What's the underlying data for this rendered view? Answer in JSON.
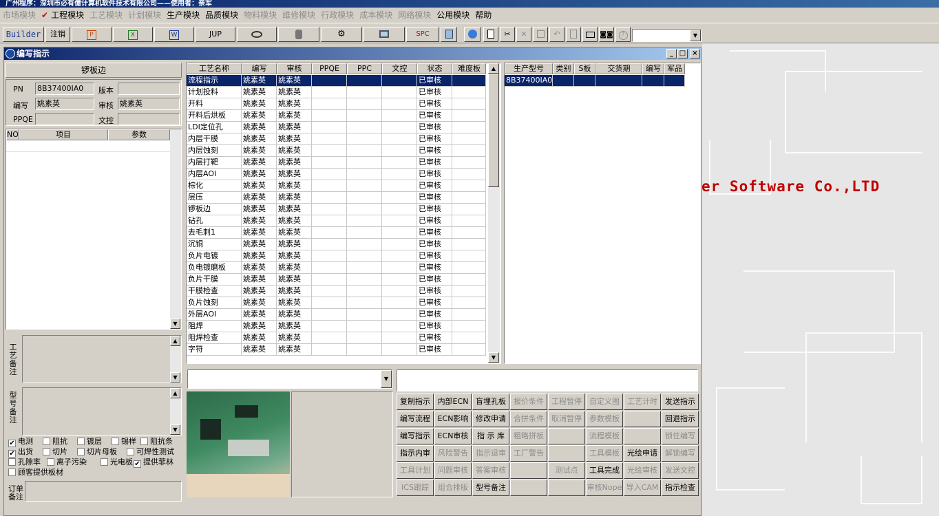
{
  "app": {
    "title": "广州程序：深圳市必有億计算机软件技术有限公司——使用者：亲军"
  },
  "menu": [
    {
      "label": "市场模块",
      "enabled": false
    },
    {
      "label": "工程模块",
      "enabled": true,
      "checked": true
    },
    {
      "label": "工艺模块",
      "enabled": false
    },
    {
      "label": "计划模块",
      "enabled": false
    },
    {
      "label": "生产模块",
      "enabled": true
    },
    {
      "label": "品质模块",
      "enabled": true
    },
    {
      "label": "物料模块",
      "enabled": false
    },
    {
      "label": "维修模块",
      "enabled": false
    },
    {
      "label": "行政模块",
      "enabled": false
    },
    {
      "label": "成本模块",
      "enabled": false
    },
    {
      "label": "网络模块",
      "enabled": false
    },
    {
      "label": "公用模块",
      "enabled": true
    },
    {
      "label": "帮助",
      "enabled": true
    }
  ],
  "toolbar": {
    "builder": "Builder",
    "logout": "注销",
    "jup": "JUP",
    "spc": "SPC"
  },
  "desktop": {
    "brand": "er Software Co.,LTD"
  },
  "window": {
    "title": "编写指示"
  },
  "left": {
    "header": "锣板边",
    "pn_label": "PN",
    "pn_value": "8B37400IA0",
    "version_label": "版本",
    "version_value": "",
    "writer_label": "编写",
    "writer_value": "姚素英",
    "review_label": "审核",
    "review_value": "姚素英",
    "ppqe_label": "PPQE",
    "ppqe_value": "",
    "doc_label": "文控",
    "doc_value": "",
    "param_cols": [
      "NO",
      "项目",
      "参数"
    ],
    "craft_note_label": "工艺备注",
    "model_note_label": "型号备注",
    "order_note_label": "订单备注",
    "checks": [
      [
        {
          "label": "电测",
          "checked": true
        },
        {
          "label": "阻抗",
          "checked": false
        },
        {
          "label": "镀层",
          "checked": false
        },
        {
          "label": "锡样",
          "checked": false
        },
        {
          "label": "阻抗条",
          "checked": false
        }
      ],
      [
        {
          "label": "出货",
          "checked": true
        },
        {
          "label": "切片",
          "checked": false
        },
        {
          "label": "切片母板",
          "checked": false
        },
        {
          "label": "可焊性测试",
          "checked": false
        }
      ],
      [
        {
          "label": "孔隙率",
          "checked": false
        },
        {
          "label": "离子污染",
          "checked": false
        },
        {
          "label": "光电板",
          "checked": false
        },
        {
          "label": "提供菲林",
          "checked": true
        }
      ],
      [
        {
          "label": "顾客提供板材",
          "checked": false
        }
      ]
    ]
  },
  "process": {
    "columns": [
      "工艺名称",
      "编写",
      "审核",
      "PPQE",
      "PPC",
      "文控",
      "状态",
      "难度板"
    ],
    "rows": [
      [
        "流程指示",
        "姚素英",
        "姚素英",
        "",
        "",
        "",
        "已审核",
        ""
      ],
      [
        "计划投料",
        "姚素英",
        "姚素英",
        "",
        "",
        "",
        "已审核",
        ""
      ],
      [
        "开料",
        "姚素英",
        "姚素英",
        "",
        "",
        "",
        "已审核",
        ""
      ],
      [
        "开料后烘板",
        "姚素英",
        "姚素英",
        "",
        "",
        "",
        "已审核",
        ""
      ],
      [
        "LDI定位孔",
        "姚素英",
        "姚素英",
        "",
        "",
        "",
        "已审核",
        ""
      ],
      [
        "内层干膜",
        "姚素英",
        "姚素英",
        "",
        "",
        "",
        "已审核",
        ""
      ],
      [
        "内层蚀刻",
        "姚素英",
        "姚素英",
        "",
        "",
        "",
        "已审核",
        ""
      ],
      [
        "内层打靶",
        "姚素英",
        "姚素英",
        "",
        "",
        "",
        "已审核",
        ""
      ],
      [
        "内层AOI",
        "姚素英",
        "姚素英",
        "",
        "",
        "",
        "已审核",
        ""
      ],
      [
        "棕化",
        "姚素英",
        "姚素英",
        "",
        "",
        "",
        "已审核",
        ""
      ],
      [
        "层压",
        "姚素英",
        "姚素英",
        "",
        "",
        "",
        "已审核",
        ""
      ],
      [
        "锣板边",
        "姚素英",
        "姚素英",
        "",
        "",
        "",
        "已审核",
        ""
      ],
      [
        "钻孔",
        "姚素英",
        "姚素英",
        "",
        "",
        "",
        "已审核",
        ""
      ],
      [
        "去毛刺1",
        "姚素英",
        "姚素英",
        "",
        "",
        "",
        "已审核",
        ""
      ],
      [
        "沉铜",
        "姚素英",
        "姚素英",
        "",
        "",
        "",
        "已审核",
        ""
      ],
      [
        "负片电镀",
        "姚素英",
        "姚素英",
        "",
        "",
        "",
        "已审核",
        ""
      ],
      [
        "负电镀磨板",
        "姚素英",
        "姚素英",
        "",
        "",
        "",
        "已审核",
        ""
      ],
      [
        "负片干膜",
        "姚素英",
        "姚素英",
        "",
        "",
        "",
        "已审核",
        ""
      ],
      [
        "干膜检查",
        "姚素英",
        "姚素英",
        "",
        "",
        "",
        "已审核",
        ""
      ],
      [
        "负片蚀刻",
        "姚素英",
        "姚素英",
        "",
        "",
        "",
        "已审核",
        ""
      ],
      [
        "外层AOI",
        "姚素英",
        "姚素英",
        "",
        "",
        "",
        "已审核",
        ""
      ],
      [
        "阻焊",
        "姚素英",
        "姚素英",
        "",
        "",
        "",
        "已审核",
        ""
      ],
      [
        "阻焊检查",
        "姚素英",
        "姚素英",
        "",
        "",
        "",
        "已审核",
        ""
      ],
      [
        "字符",
        "姚素英",
        "姚素英",
        "",
        "",
        "",
        "已审核",
        ""
      ]
    ],
    "selected": 0
  },
  "products": {
    "columns": [
      "生产型号",
      "类别",
      "S板",
      "交货期",
      "编写",
      "军品"
    ],
    "rows": [
      [
        "8B37400IA0",
        "",
        "",
        "",
        "",
        ""
      ]
    ]
  },
  "actions": [
    [
      {
        "label": "复制指示",
        "enabled": true
      },
      {
        "label": "内部ECN",
        "enabled": true
      },
      {
        "label": "盲埋孔板",
        "enabled": true
      },
      {
        "label": "报价条件",
        "enabled": false
      },
      {
        "label": "工程暂停",
        "enabled": false
      },
      {
        "label": "自定义图",
        "enabled": false
      },
      {
        "label": "工艺计时",
        "enabled": false
      },
      {
        "label": "发送指示",
        "enabled": true
      }
    ],
    [
      {
        "label": "编写流程",
        "enabled": true
      },
      {
        "label": "ECN影响",
        "enabled": true
      },
      {
        "label": "修改申请",
        "enabled": true
      },
      {
        "label": "合拼条件",
        "enabled": false
      },
      {
        "label": "取消暂停",
        "enabled": false
      },
      {
        "label": "参数模板",
        "enabled": false
      },
      {
        "label": "",
        "enabled": false
      },
      {
        "label": "回退指示",
        "enabled": true
      }
    ],
    [
      {
        "label": "编写指示",
        "enabled": true
      },
      {
        "label": "ECN审核",
        "enabled": true
      },
      {
        "label": "指 示 库",
        "enabled": true
      },
      {
        "label": "粗略拼板",
        "enabled": false
      },
      {
        "label": "",
        "enabled": false
      },
      {
        "label": "流程模板",
        "enabled": false
      },
      {
        "label": "",
        "enabled": false
      },
      {
        "label": "锁住编写",
        "enabled": false
      }
    ],
    [
      {
        "label": "指示内审",
        "enabled": true
      },
      {
        "label": "风险警告",
        "enabled": false
      },
      {
        "label": "指示退审",
        "enabled": false
      },
      {
        "label": "工厂警告",
        "enabled": false
      },
      {
        "label": "",
        "enabled": false
      },
      {
        "label": "工具模板",
        "enabled": false
      },
      {
        "label": "光绘申请",
        "enabled": true
      },
      {
        "label": "解锁编写",
        "enabled": false
      }
    ],
    [
      {
        "label": "工具计划",
        "enabled": false
      },
      {
        "label": "问题审核",
        "enabled": false
      },
      {
        "label": "答案审核",
        "enabled": false
      },
      {
        "label": "",
        "enabled": false
      },
      {
        "label": "测试点",
        "enabled": false
      },
      {
        "label": "工具完成",
        "enabled": true
      },
      {
        "label": "光绘审核",
        "enabled": false
      },
      {
        "label": "发送文控",
        "enabled": false
      }
    ],
    [
      {
        "label": "ICS跟踪",
        "enabled": false
      },
      {
        "label": "组合排版",
        "enabled": false
      },
      {
        "label": "型号备注",
        "enabled": true
      },
      {
        "label": "",
        "enabled": false
      },
      {
        "label": "",
        "enabled": false
      },
      {
        "label": "审核Nope",
        "enabled": false
      },
      {
        "label": "导入CAM",
        "enabled": false
      },
      {
        "label": "指示检查",
        "enabled": true
      }
    ]
  ],
  "colors": {
    "selection": "#0a246a",
    "brand": "#c00000",
    "title_start": "#0a246a",
    "title_end": "#a6caf0"
  }
}
